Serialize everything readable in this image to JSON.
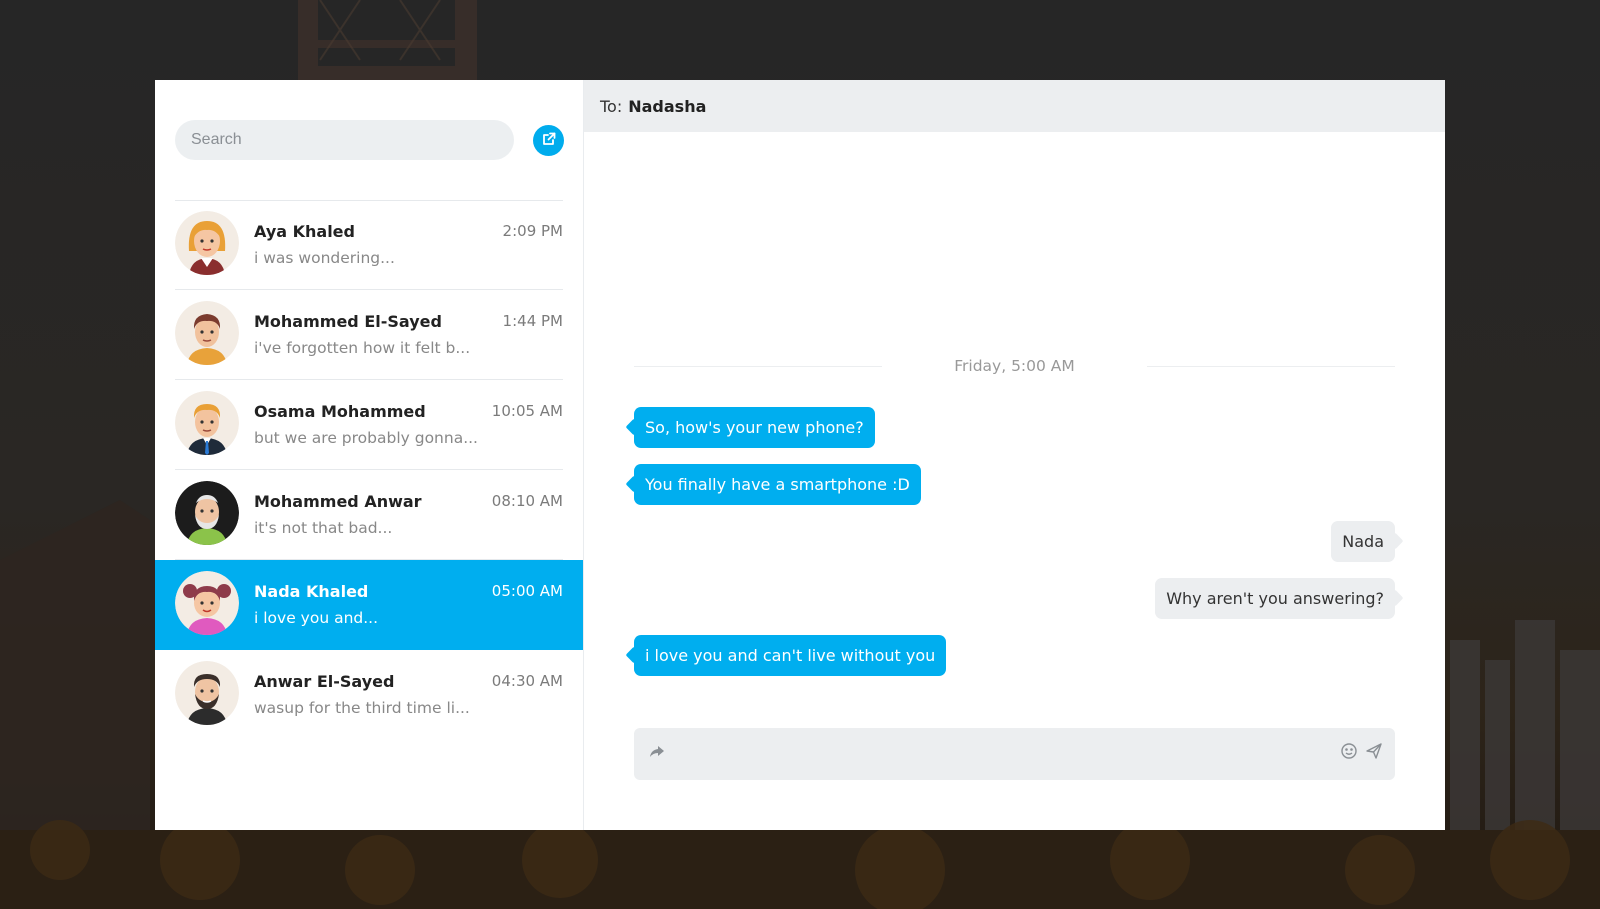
{
  "search": {
    "placeholder": "Search"
  },
  "compose": {
    "icon": "external-link-icon"
  },
  "contacts": [
    {
      "name": "Aya Khaled",
      "time": "2:09 PM",
      "preview": "i was wondering...",
      "avatar": "avatar-woman-blonde"
    },
    {
      "name": "Mohammed El-Sayed",
      "time": "1:44 PM",
      "preview": "i've forgotten how it felt b...",
      "avatar": "avatar-man-brown-hair"
    },
    {
      "name": "Osama Mohammed",
      "time": "10:05 AM",
      "preview": "but we are probably gonna...",
      "avatar": "avatar-man-suit"
    },
    {
      "name": "Mohammed Anwar",
      "time": "08:10 AM",
      "preview": "it's not that bad...",
      "avatar": "avatar-old-man"
    },
    {
      "name": "Nada Khaled",
      "time": "05:00 AM",
      "preview": "i love you and...",
      "avatar": "avatar-girl-pigtails",
      "active": true
    },
    {
      "name": "Anwar El-Sayed",
      "time": "04:30 AM",
      "preview": "wasup for the third time li...",
      "avatar": "avatar-man-beard"
    }
  ],
  "chat": {
    "to_label": "To:",
    "to_name": "Nadasha",
    "date_separator": "Friday, 5:00 AM",
    "messages": [
      {
        "dir": "in",
        "text": "So, how's your new phone?"
      },
      {
        "dir": "in",
        "text": "You finally have a smartphone :D"
      },
      {
        "dir": "out",
        "text": "Nada"
      },
      {
        "dir": "out",
        "text": "Why aren't you answering?"
      },
      {
        "dir": "in",
        "text": "i love you and can't live without you"
      }
    ],
    "composer": {
      "value": "",
      "icons": [
        "forward-icon",
        "emoji-icon",
        "send-icon"
      ]
    }
  },
  "colors": {
    "accent": "#00AEEF",
    "incoming_bubble": "#00AEEF",
    "outgoing_bubble": "#ECEEF0",
    "header_bg": "#ECEEF0"
  }
}
